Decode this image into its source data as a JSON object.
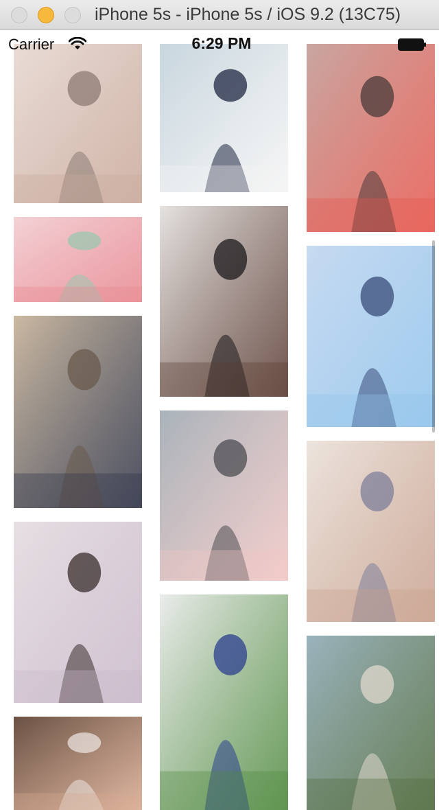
{
  "window": {
    "title": "iPhone 5s - iPhone 5s / iOS 9.2 (13C75)"
  },
  "status_bar": {
    "carrier": "Carrier",
    "time": "6:29 PM",
    "wifi_icon": "wifi-icon",
    "battery_icon": "battery-icon"
  },
  "gallery": {
    "columns": 3,
    "photos": [
      {
        "column": 1,
        "description": "photo",
        "palette": [
          "#e9ddd6",
          "#c9a89a",
          "#8d7b74"
        ]
      },
      {
        "column": 1,
        "description": "photo",
        "palette": [
          "#f3d2d6",
          "#e7878f",
          "#9bc7b0"
        ]
      },
      {
        "column": 1,
        "description": "photo",
        "palette": [
          "#cbb9a2",
          "#2f3447",
          "#6a5a4c"
        ]
      },
      {
        "column": 1,
        "description": "photo",
        "palette": [
          "#e6dfe3",
          "#c9b8c9",
          "#3a2d2c"
        ]
      },
      {
        "column": 1,
        "description": "photo",
        "palette": [
          "#6a5143",
          "#d8a98f",
          "#eae2dc"
        ]
      },
      {
        "column": 2,
        "description": "photo",
        "palette": [
          "#c8d6de",
          "#f4f4f4",
          "#1f2741"
        ]
      },
      {
        "column": 2,
        "description": "photo",
        "palette": [
          "#e5e2e0",
          "#5a3b32",
          "#1c1a1c"
        ]
      },
      {
        "column": 2,
        "description": "photo",
        "palette": [
          "#a9b3ba",
          "#f0c6c4",
          "#4c4c52"
        ]
      },
      {
        "column": 2,
        "description": "photo",
        "palette": [
          "#eaeceb",
          "#4f8a3e",
          "#2c3f8f"
        ]
      },
      {
        "column": 3,
        "description": "photo",
        "palette": [
          "#c9a6a1",
          "#e6574c",
          "#4a3b3a"
        ]
      },
      {
        "column": 3,
        "description": "photo",
        "palette": [
          "#c7daf0",
          "#8fc3ec",
          "#3a4c7a"
        ]
      },
      {
        "column": 3,
        "description": "photo",
        "palette": [
          "#ece4dd",
          "#c8a08d",
          "#7d7f9a"
        ]
      },
      {
        "column": 3,
        "description": "photo",
        "palette": [
          "#9ab3bd",
          "#4f6a3c",
          "#e1d8ce"
        ]
      }
    ]
  }
}
